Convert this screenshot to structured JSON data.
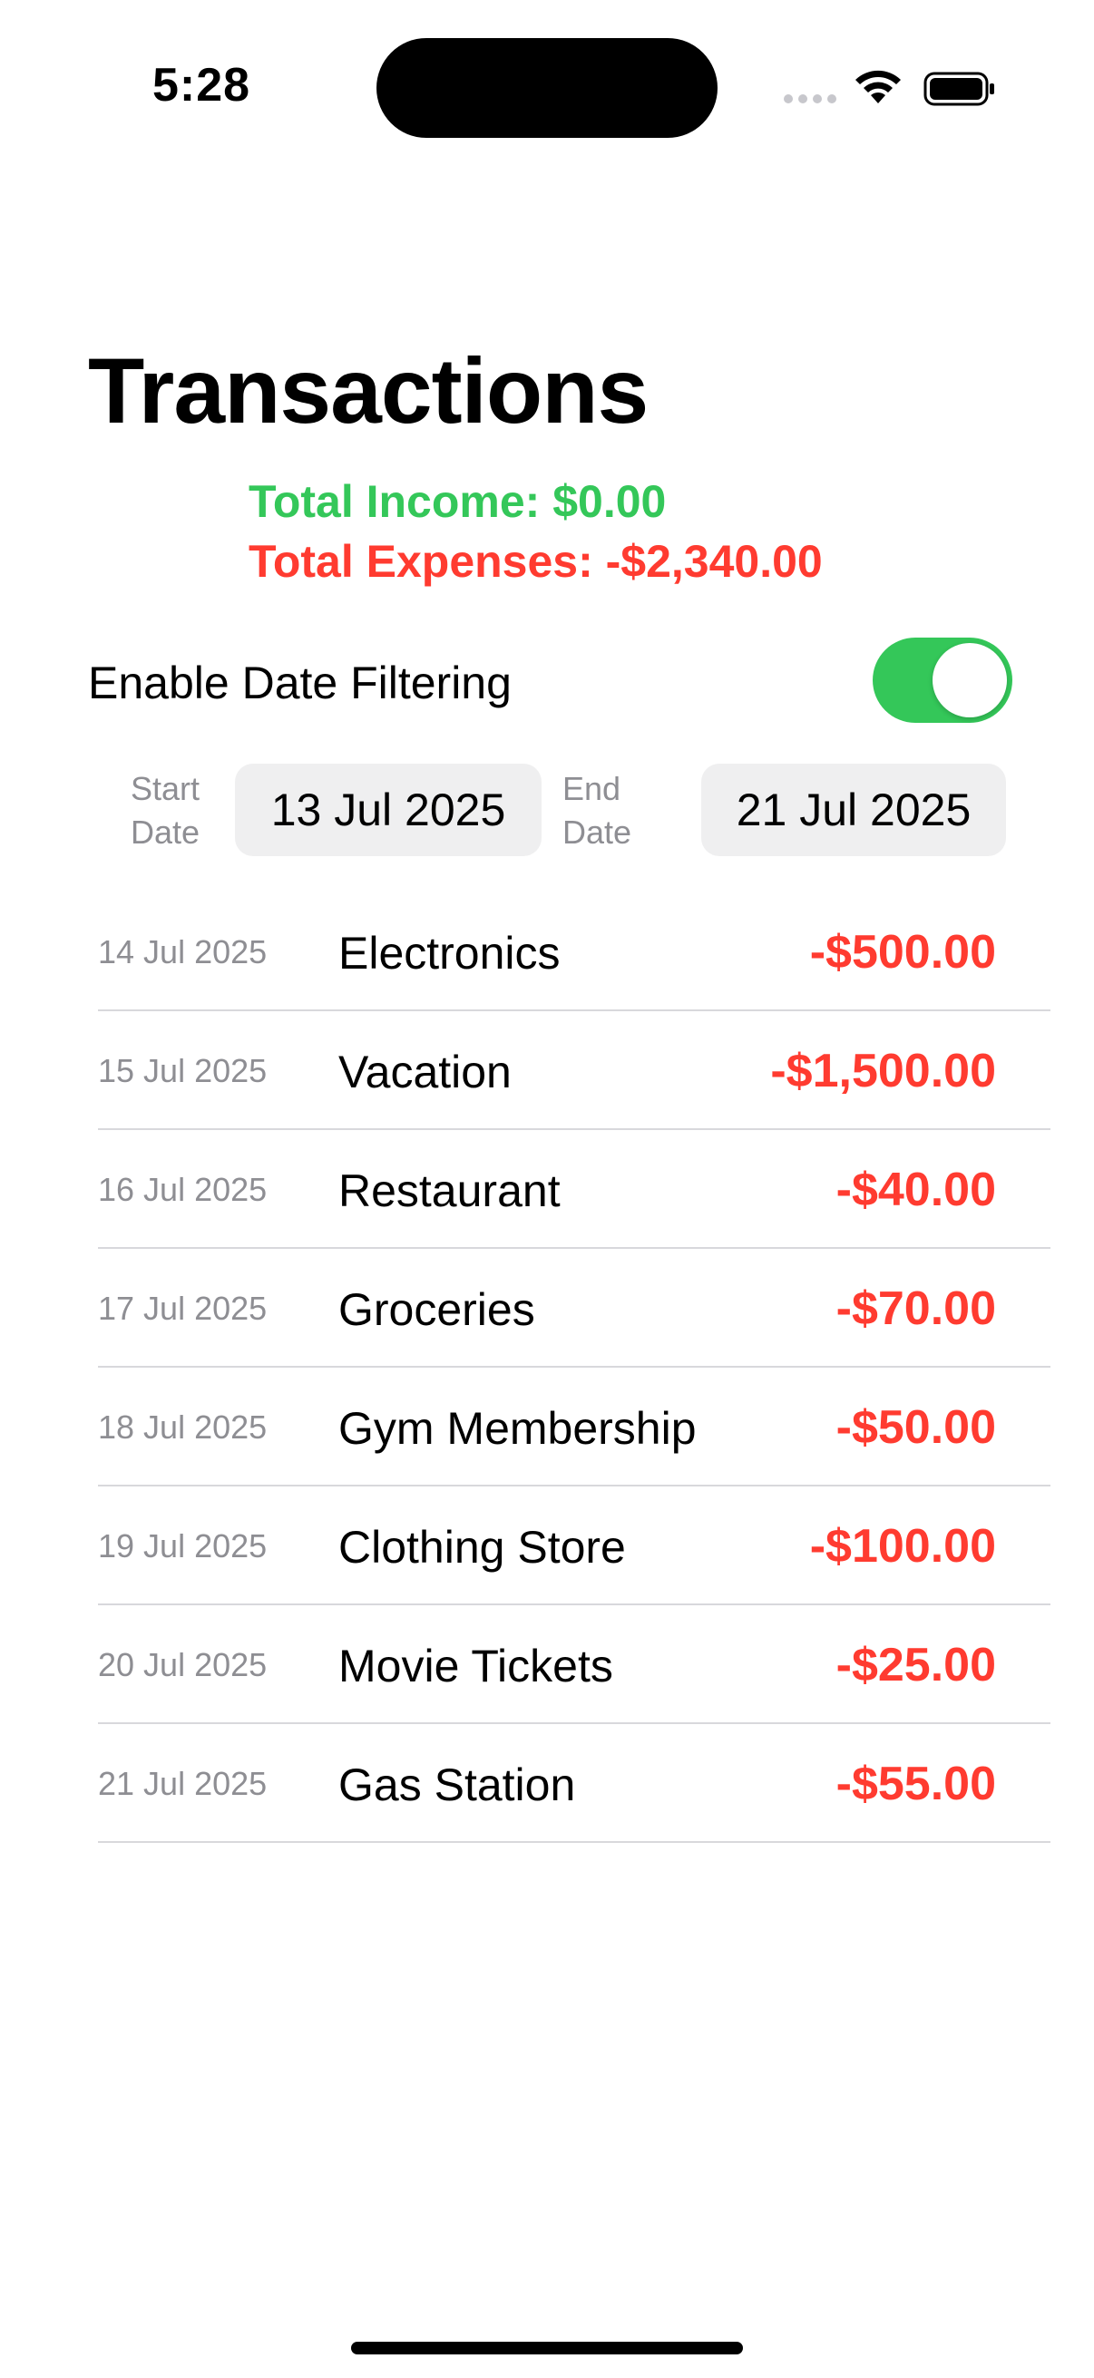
{
  "status_bar": {
    "time": "5:28"
  },
  "header": {
    "title": "Transactions",
    "total_income": "Total Income: $0.00",
    "total_expenses": "Total Expenses: -$2,340.00"
  },
  "filter": {
    "label": "Enable Date Filtering",
    "enabled": true,
    "start_caption_line1": "Start",
    "start_caption_line2": "Date",
    "start_date": "13 Jul 2025",
    "end_caption_line1": "End",
    "end_caption_line2": "Date",
    "end_date": "21 Jul 2025"
  },
  "transactions": [
    {
      "date": "14 Jul 2025",
      "name": "Electronics",
      "amount": "-$500.00"
    },
    {
      "date": "15 Jul 2025",
      "name": "Vacation",
      "amount": "-$1,500.00"
    },
    {
      "date": "16 Jul 2025",
      "name": "Restaurant",
      "amount": "-$40.00"
    },
    {
      "date": "17 Jul 2025",
      "name": "Groceries",
      "amount": "-$70.00"
    },
    {
      "date": "18 Jul 2025",
      "name": "Gym Membership",
      "amount": "-$50.00"
    },
    {
      "date": "19 Jul 2025",
      "name": "Clothing Store",
      "amount": "-$100.00"
    },
    {
      "date": "20 Jul 2025",
      "name": "Movie Tickets",
      "amount": "-$25.00"
    },
    {
      "date": "21 Jul 2025",
      "name": "Gas Station",
      "amount": "-$55.00"
    }
  ],
  "colors": {
    "income": "#34c759",
    "expense": "#ff3b30",
    "toggle_on": "#34c759"
  },
  "icons": [
    "signal-icon",
    "wifi-icon",
    "battery-icon"
  ]
}
